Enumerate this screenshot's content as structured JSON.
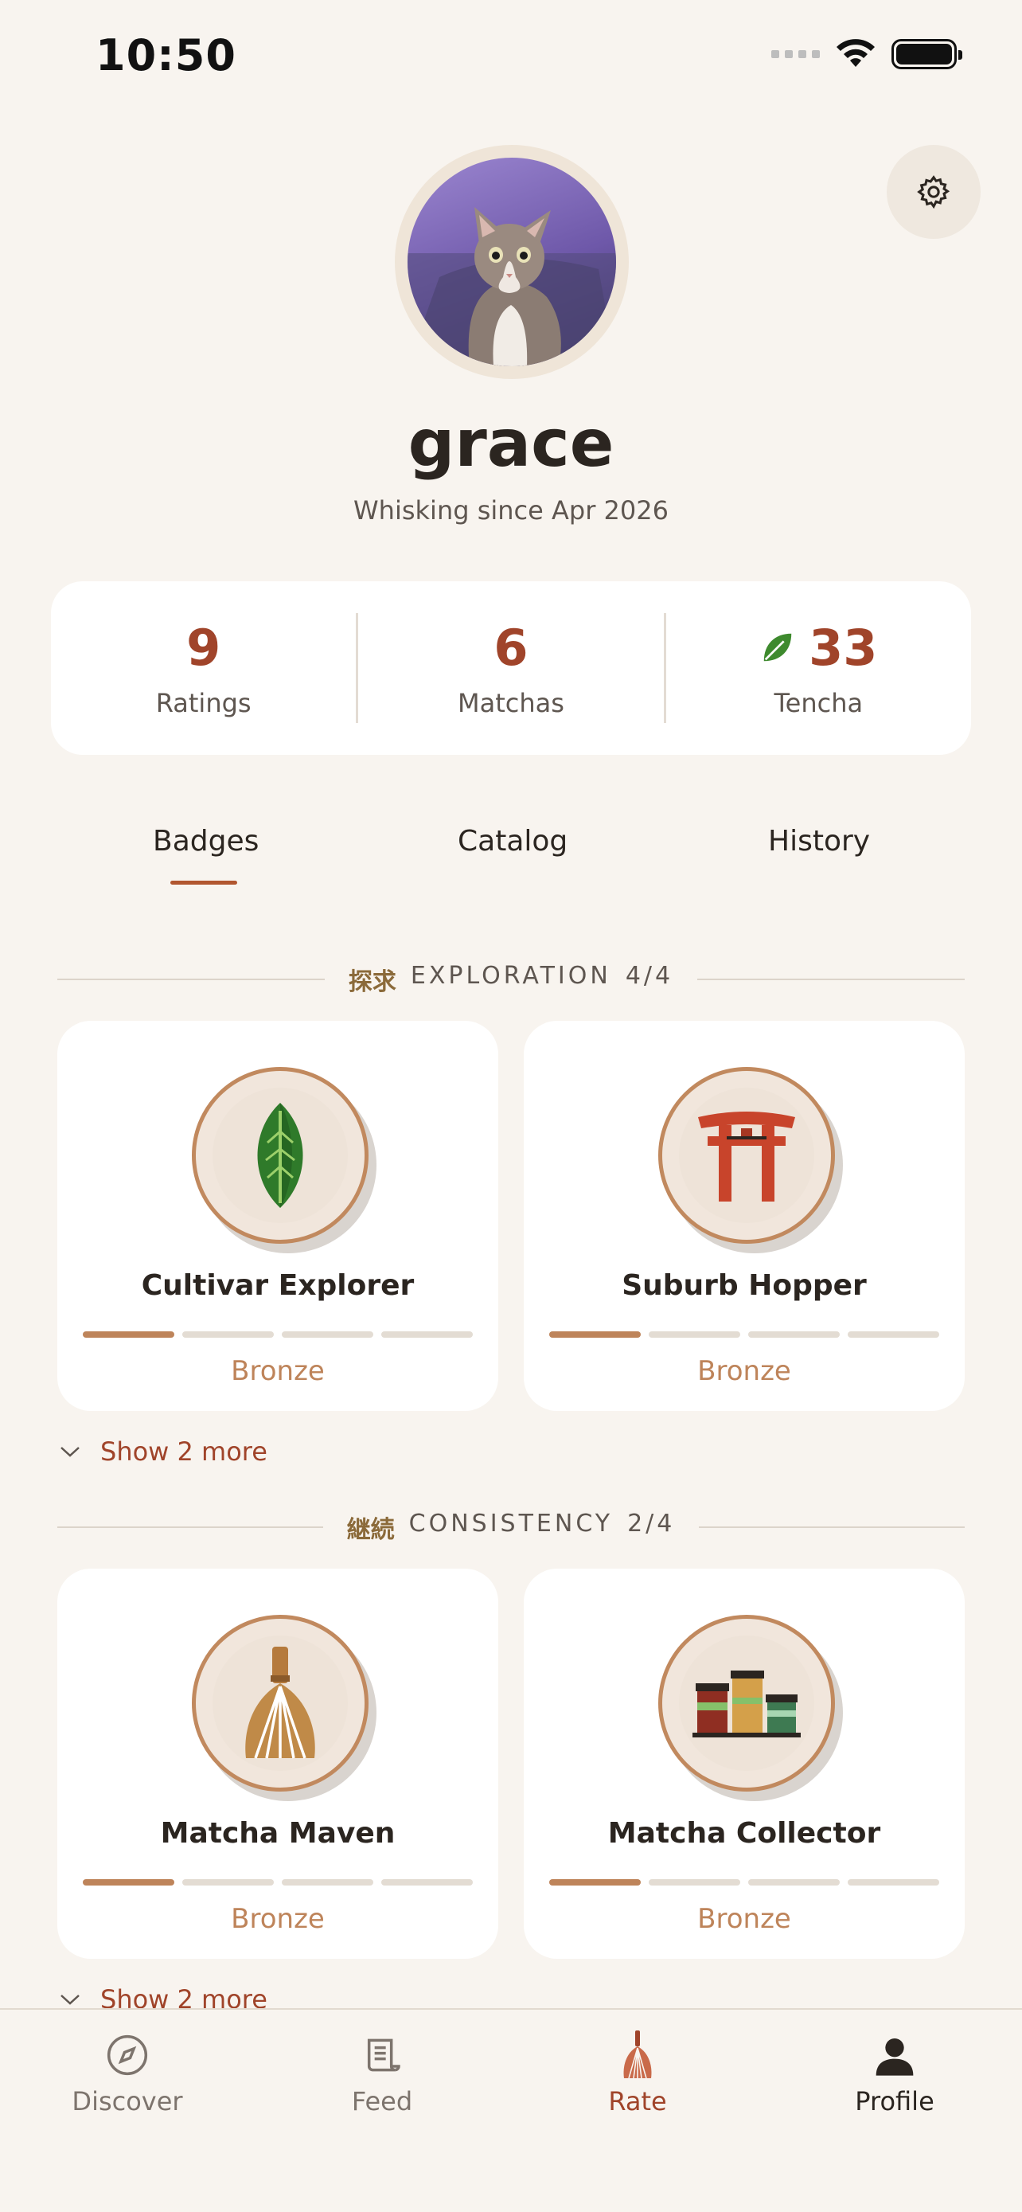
{
  "status_bar": {
    "time": "10:50"
  },
  "profile": {
    "username": "grace",
    "since": "Whisking since Apr 2026"
  },
  "stats": [
    {
      "value": "9",
      "label": "Ratings"
    },
    {
      "value": "6",
      "label": "Matchas"
    },
    {
      "value": "33",
      "label": "Tencha",
      "icon": "leaf-icon"
    }
  ],
  "tabs": [
    {
      "label": "Badges",
      "active": true
    },
    {
      "label": "Catalog",
      "active": false
    },
    {
      "label": "History",
      "active": false
    }
  ],
  "sections": [
    {
      "kanji": "探求",
      "title": "EXPLORATION",
      "count": "4/4",
      "badges": [
        {
          "name": "Cultivar Explorer",
          "tier": "Bronze",
          "icon": "leaf-icon",
          "progress": 1,
          "steps": 4
        },
        {
          "name": "Suburb Hopper",
          "tier": "Bronze",
          "icon": "torii-gate-icon",
          "progress": 1,
          "steps": 4
        }
      ],
      "show_more": "Show 2 more"
    },
    {
      "kanji": "継続",
      "title": "CONSISTENCY",
      "count": "2/4",
      "badges": [
        {
          "name": "Matcha Maven",
          "tier": "Bronze",
          "icon": "chasen-whisk-icon",
          "progress": 1,
          "steps": 4
        },
        {
          "name": "Matcha Collector",
          "tier": "Bronze",
          "icon": "tea-tins-icon",
          "progress": 1,
          "steps": 4
        }
      ],
      "show_more": "Show 2 more"
    }
  ],
  "bottom_nav": [
    {
      "label": "Discover",
      "icon": "compass-icon",
      "state": "inactive"
    },
    {
      "label": "Feed",
      "icon": "scroll-icon",
      "state": "inactive"
    },
    {
      "label": "Rate",
      "icon": "whisk-icon",
      "state": "accent"
    },
    {
      "label": "Profile",
      "icon": "person-icon",
      "state": "active"
    }
  ],
  "colors": {
    "background": "#F8F4EF",
    "accent": "#A0442A",
    "bronze": "#BE845A",
    "card": "#FFFFFF"
  }
}
